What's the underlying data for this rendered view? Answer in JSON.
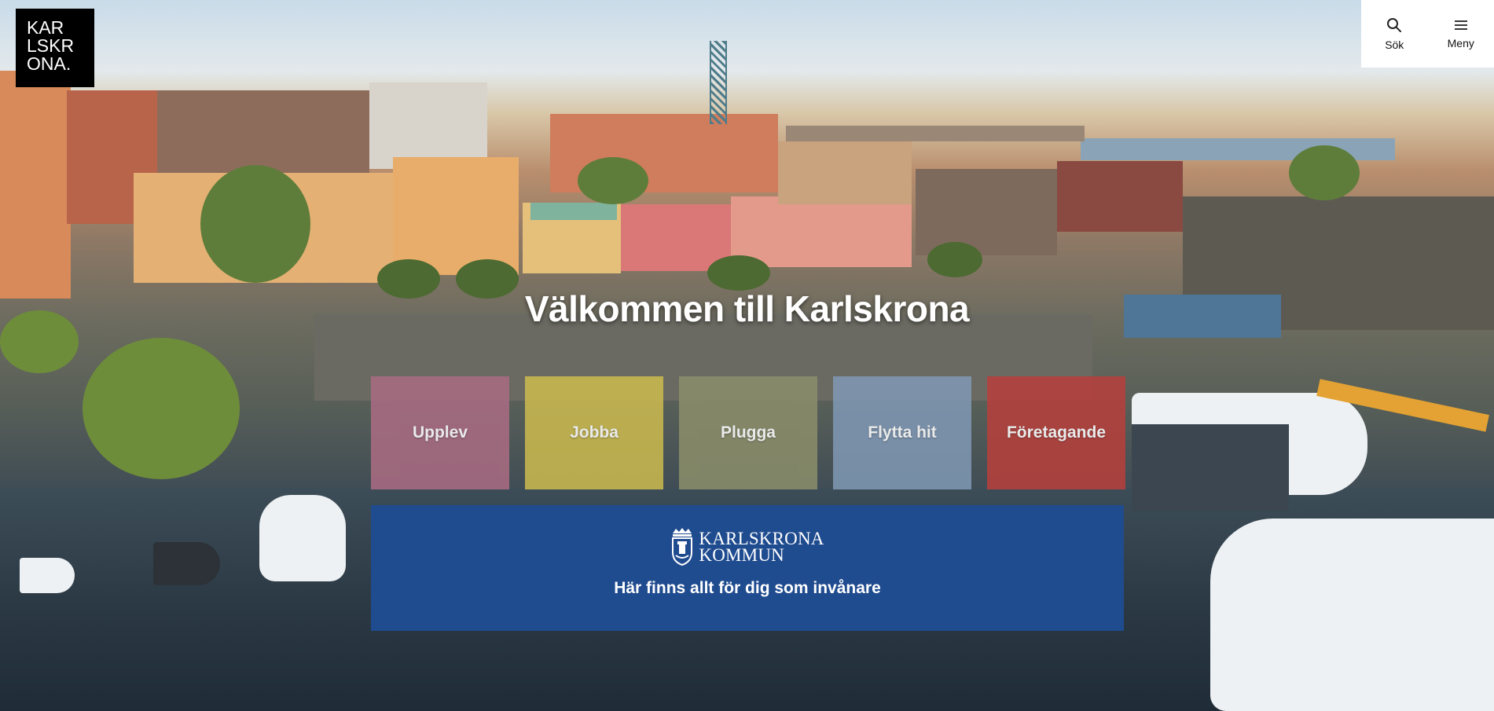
{
  "logo": {
    "lines": [
      "KAR",
      "LSKR",
      "ONA."
    ]
  },
  "tools": {
    "search": {
      "label": "Sök",
      "icon": "search-icon"
    },
    "menu": {
      "label": "Meny",
      "icon": "hamburger-menu-icon"
    }
  },
  "hero": {
    "title": "Välkommen till Karlskrona"
  },
  "tiles": [
    {
      "label": "Upplev",
      "color": "#a86b82"
    },
    {
      "label": "Jobba",
      "color": "#c9b84f"
    },
    {
      "label": "Plugga",
      "color": "#8a8d6a"
    },
    {
      "label": "Flytta hit",
      "color": "#7f97b3"
    },
    {
      "label": "Företagande",
      "color": "#b5403c"
    }
  ],
  "kommun": {
    "name_lines": [
      "KARLSKRONA",
      "KOMMUN"
    ],
    "tagline": "Här finns allt för dig som invånare",
    "color": "#1f4b8f"
  }
}
